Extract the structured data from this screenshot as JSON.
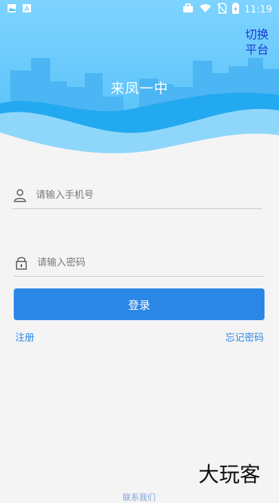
{
  "status_bar": {
    "time": "11:19",
    "icons": [
      "image-icon",
      "a-icon",
      "briefcase-icon",
      "wifi-icon",
      "no-sim-icon",
      "battery-icon"
    ]
  },
  "header": {
    "title": "来凤一中",
    "switch_label_line1": "切换",
    "switch_label_line2": "平台"
  },
  "form": {
    "phone_placeholder": "请输入手机号",
    "password_placeholder": "请输入密码",
    "login_label": "登录",
    "register_label": "注册",
    "forgot_label": "忘记密码"
  },
  "footer": {
    "partial_text": "联系我们"
  },
  "watermark": {
    "text": "大玩客"
  },
  "colors": {
    "primary": "#2b87e6",
    "switch_text": "#1a39d1",
    "header_sky": "#7fd4ff",
    "background": "#f4f4f4"
  }
}
